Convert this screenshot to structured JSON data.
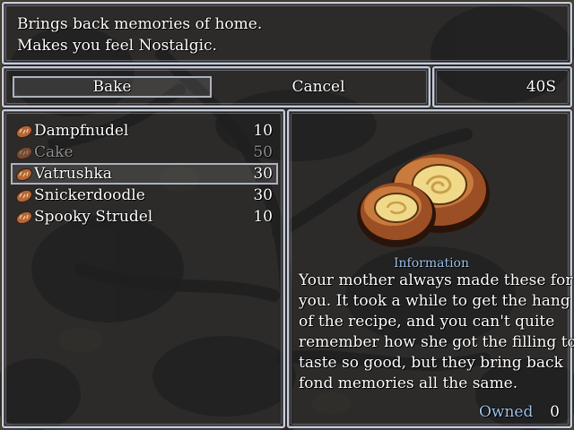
{
  "help": {
    "lines": [
      "Brings back memories of home.",
      "Makes you feel Nostalgic."
    ]
  },
  "command": {
    "bake_label": "Bake",
    "cancel_label": "Cancel",
    "selected": "Bake"
  },
  "gold": {
    "display": "40S"
  },
  "items": [
    {
      "name": "Dampfnudel",
      "count": "10",
      "enabled": true,
      "icon": "bread-icon"
    },
    {
      "name": "Cake",
      "count": "50",
      "enabled": false,
      "icon": "bread-icon"
    },
    {
      "name": "Vatrushka",
      "count": "30",
      "enabled": true,
      "icon": "bread-icon",
      "selected": true
    },
    {
      "name": "Snickerdoodle",
      "count": "30",
      "enabled": true,
      "icon": "bread-icon"
    },
    {
      "name": "Spooky Strudel",
      "count": "10",
      "enabled": true,
      "icon": "bread-icon"
    }
  ],
  "info": {
    "title": "Information",
    "description": [
      "Your mother always made these for",
      "you. It took a while to get the hang",
      "of the recipe, and you can't quite",
      "remember how she got the filling to",
      "taste so good, but they bring back",
      "fond memories all the same."
    ],
    "owned_label": "Owned",
    "owned_value": "0",
    "image": "vatrushka-pastry-image"
  },
  "colors": {
    "system_blue": "#9fc4e8",
    "disabled_text": "#a0a0a0",
    "window_border": "#c9ccd6"
  }
}
